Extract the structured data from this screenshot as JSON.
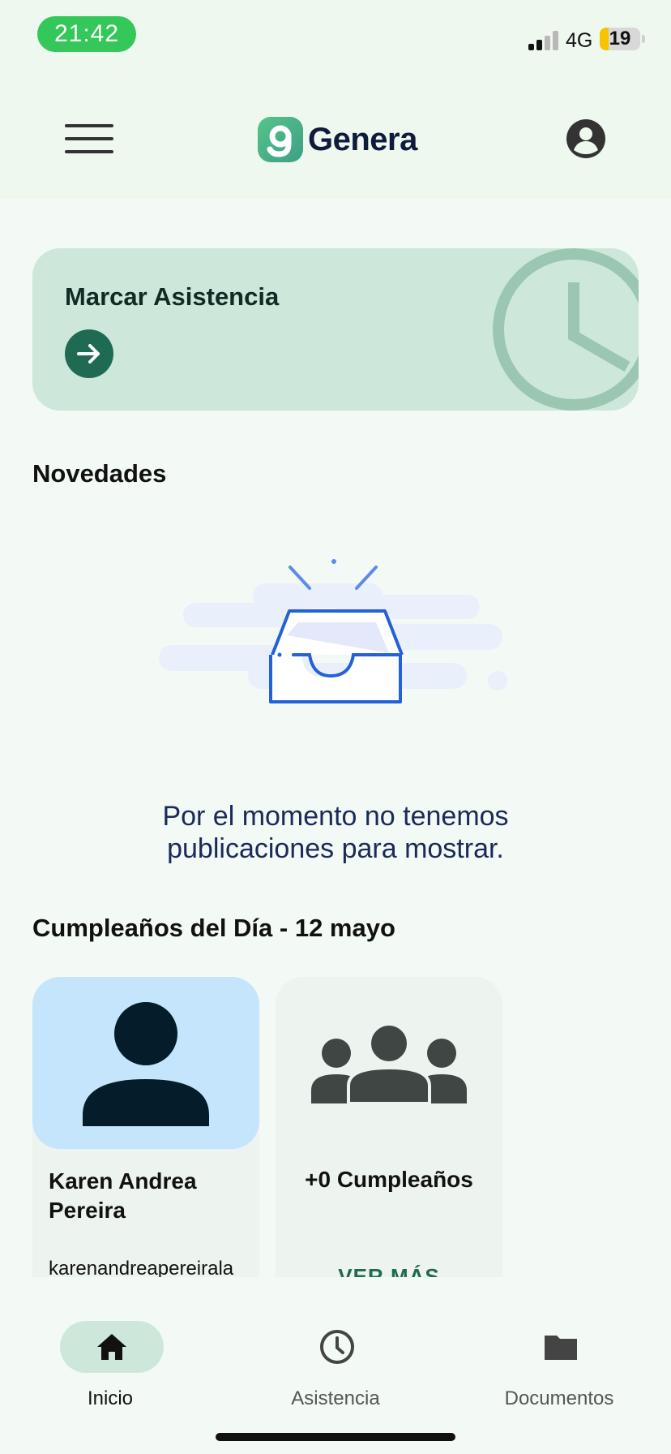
{
  "status_bar": {
    "time": "21:42",
    "network": "4G",
    "battery": "19",
    "battery_color": "#f6c400"
  },
  "header": {
    "menu_icon": "hamburger-icon",
    "logo_text": "Genera",
    "profile_icon": "account-circle-icon"
  },
  "attendance": {
    "title": "Marcar Asistencia",
    "arrow_icon": "arrow-right-icon",
    "decoration_icon": "clock-icon"
  },
  "news": {
    "title": "Novedades",
    "empty_illustration": "empty-inbox-icon",
    "empty_message": "Por el momento no tenemos publicaciones para mostrar."
  },
  "birthdays": {
    "title": "Cumpleaños del Día - 12 mayo",
    "person": {
      "name": "Karen Andrea Pereira",
      "email": "karenandreapereirala",
      "avatar_icon": "person-icon"
    },
    "summary": {
      "count_label": "+0 Cumpleaños",
      "more_label": "VER MÁS",
      "icon": "group-icon"
    }
  },
  "bottom_nav": [
    {
      "label": "Inicio",
      "icon": "home-icon",
      "active": true
    },
    {
      "label": "Asistencia",
      "icon": "clock-icon",
      "active": false
    },
    {
      "label": "Documentos",
      "icon": "folder-icon",
      "active": false
    }
  ],
  "colors": {
    "background": "#f3f9f4",
    "accent": "#1e6a52",
    "card": "#cde8da",
    "message_text": "#1a2a5a"
  }
}
